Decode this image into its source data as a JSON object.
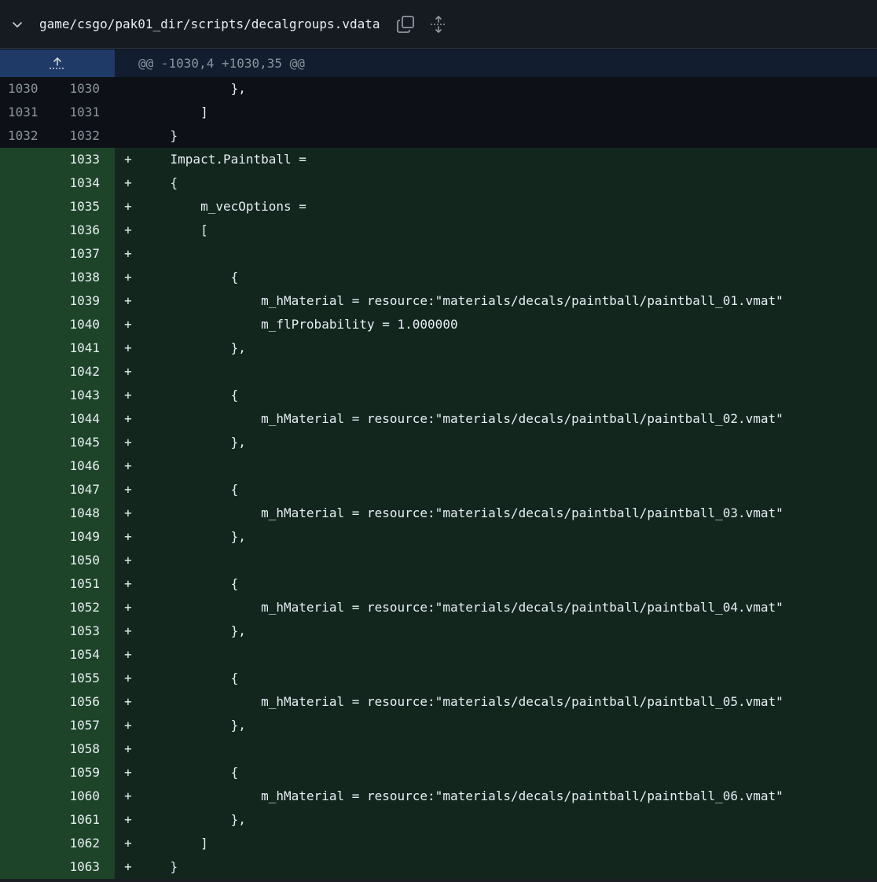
{
  "header": {
    "file_path": "game/csgo/pak01_dir/scripts/decalgroups.vdata"
  },
  "hunk": {
    "header": "@@ -1030,4 +1030,35 @@"
  },
  "lines": [
    {
      "type": "ctx",
      "old": "1030",
      "new": "1030",
      "marker": "",
      "code": "            },"
    },
    {
      "type": "ctx",
      "old": "1031",
      "new": "1031",
      "marker": "",
      "code": "        ]"
    },
    {
      "type": "ctx",
      "old": "1032",
      "new": "1032",
      "marker": "",
      "code": "    }"
    },
    {
      "type": "add",
      "old": "",
      "new": "1033",
      "marker": "+",
      "code": "    Impact.Paintball ="
    },
    {
      "type": "add",
      "old": "",
      "new": "1034",
      "marker": "+",
      "code": "    {"
    },
    {
      "type": "add",
      "old": "",
      "new": "1035",
      "marker": "+",
      "code": "        m_vecOptions ="
    },
    {
      "type": "add",
      "old": "",
      "new": "1036",
      "marker": "+",
      "code": "        ["
    },
    {
      "type": "add",
      "old": "",
      "new": "1037",
      "marker": "+",
      "code": ""
    },
    {
      "type": "add",
      "old": "",
      "new": "1038",
      "marker": "+",
      "code": "            {"
    },
    {
      "type": "add",
      "old": "",
      "new": "1039",
      "marker": "+",
      "code": "                m_hMaterial = resource:\"materials/decals/paintball/paintball_01.vmat\""
    },
    {
      "type": "add",
      "old": "",
      "new": "1040",
      "marker": "+",
      "code": "                m_flProbability = 1.000000"
    },
    {
      "type": "add",
      "old": "",
      "new": "1041",
      "marker": "+",
      "code": "            },"
    },
    {
      "type": "add",
      "old": "",
      "new": "1042",
      "marker": "+",
      "code": ""
    },
    {
      "type": "add",
      "old": "",
      "new": "1043",
      "marker": "+",
      "code": "            {"
    },
    {
      "type": "add",
      "old": "",
      "new": "1044",
      "marker": "+",
      "code": "                m_hMaterial = resource:\"materials/decals/paintball/paintball_02.vmat\""
    },
    {
      "type": "add",
      "old": "",
      "new": "1045",
      "marker": "+",
      "code": "            },"
    },
    {
      "type": "add",
      "old": "",
      "new": "1046",
      "marker": "+",
      "code": ""
    },
    {
      "type": "add",
      "old": "",
      "new": "1047",
      "marker": "+",
      "code": "            {"
    },
    {
      "type": "add",
      "old": "",
      "new": "1048",
      "marker": "+",
      "code": "                m_hMaterial = resource:\"materials/decals/paintball/paintball_03.vmat\""
    },
    {
      "type": "add",
      "old": "",
      "new": "1049",
      "marker": "+",
      "code": "            },"
    },
    {
      "type": "add",
      "old": "",
      "new": "1050",
      "marker": "+",
      "code": ""
    },
    {
      "type": "add",
      "old": "",
      "new": "1051",
      "marker": "+",
      "code": "            {"
    },
    {
      "type": "add",
      "old": "",
      "new": "1052",
      "marker": "+",
      "code": "                m_hMaterial = resource:\"materials/decals/paintball/paintball_04.vmat\""
    },
    {
      "type": "add",
      "old": "",
      "new": "1053",
      "marker": "+",
      "code": "            },"
    },
    {
      "type": "add",
      "old": "",
      "new": "1054",
      "marker": "+",
      "code": ""
    },
    {
      "type": "add",
      "old": "",
      "new": "1055",
      "marker": "+",
      "code": "            {"
    },
    {
      "type": "add",
      "old": "",
      "new": "1056",
      "marker": "+",
      "code": "                m_hMaterial = resource:\"materials/decals/paintball/paintball_05.vmat\""
    },
    {
      "type": "add",
      "old": "",
      "new": "1057",
      "marker": "+",
      "code": "            },"
    },
    {
      "type": "add",
      "old": "",
      "new": "1058",
      "marker": "+",
      "code": ""
    },
    {
      "type": "add",
      "old": "",
      "new": "1059",
      "marker": "+",
      "code": "            {"
    },
    {
      "type": "add",
      "old": "",
      "new": "1060",
      "marker": "+",
      "code": "                m_hMaterial = resource:\"materials/decals/paintball/paintball_06.vmat\""
    },
    {
      "type": "add",
      "old": "",
      "new": "1061",
      "marker": "+",
      "code": "            },"
    },
    {
      "type": "add",
      "old": "",
      "new": "1062",
      "marker": "+",
      "code": "        ]"
    },
    {
      "type": "add",
      "old": "",
      "new": "1063",
      "marker": "+",
      "code": "    }"
    }
  ],
  "colors": {
    "added_bg": "#12261e",
    "added_gutter": "#1d4428",
    "hunk_bg": "#121d2f",
    "expand_bg": "#1f3a66",
    "page_bg": "#0d1117"
  }
}
